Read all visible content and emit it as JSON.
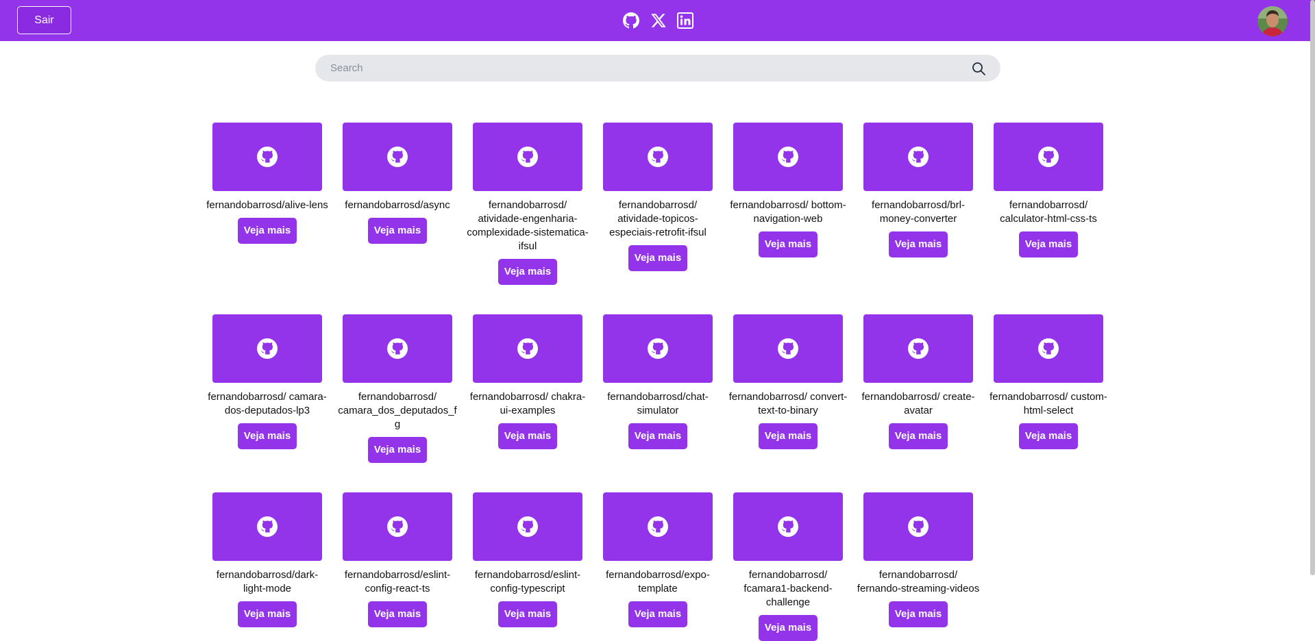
{
  "header": {
    "logout_label": "Sair",
    "social_icons": [
      "github-icon",
      "x-icon",
      "linkedin-icon"
    ],
    "avatar_icon": "user-avatar",
    "background_color": "#9333ea"
  },
  "search": {
    "placeholder": "Search",
    "value": "",
    "icon": "search-icon"
  },
  "card_button_label": "Veja mais",
  "repos": [
    {
      "title": "fernandobarrosd/alive-lens"
    },
    {
      "title": "fernandobarrosd/async"
    },
    {
      "title": "fernandobarrosd/ atividade-engenharia-complexidade-sistematica-ifsul"
    },
    {
      "title": "fernandobarrosd/ atividade-topicos-especiais-retrofit-ifsul"
    },
    {
      "title": "fernandobarrosd/ bottom-navigation-web"
    },
    {
      "title": "fernandobarrosd/brl-money-converter"
    },
    {
      "title": "fernandobarrosd/ calculator-html-css-ts"
    },
    {
      "title": "fernandobarrosd/ camara-dos-deputados-lp3"
    },
    {
      "title": "fernandobarrosd/ camara_dos_deputados_fg"
    },
    {
      "title": "fernandobarrosd/ chakra-ui-examples"
    },
    {
      "title": "fernandobarrosd/chat-simulator"
    },
    {
      "title": "fernandobarrosd/ convert-text-to-binary"
    },
    {
      "title": "fernandobarrosd/ create-avatar"
    },
    {
      "title": "fernandobarrosd/ custom-html-select"
    },
    {
      "title": "fernandobarrosd/dark-light-mode"
    },
    {
      "title": "fernandobarrosd/eslint-config-react-ts"
    },
    {
      "title": "fernandobarrosd/eslint-config-typescript"
    },
    {
      "title": "fernandobarrosd/expo-template"
    },
    {
      "title": "fernandobarrosd/ fcamara1-backend-challenge"
    },
    {
      "title": "fernandobarrosd/ fernando-streaming-videos"
    }
  ]
}
